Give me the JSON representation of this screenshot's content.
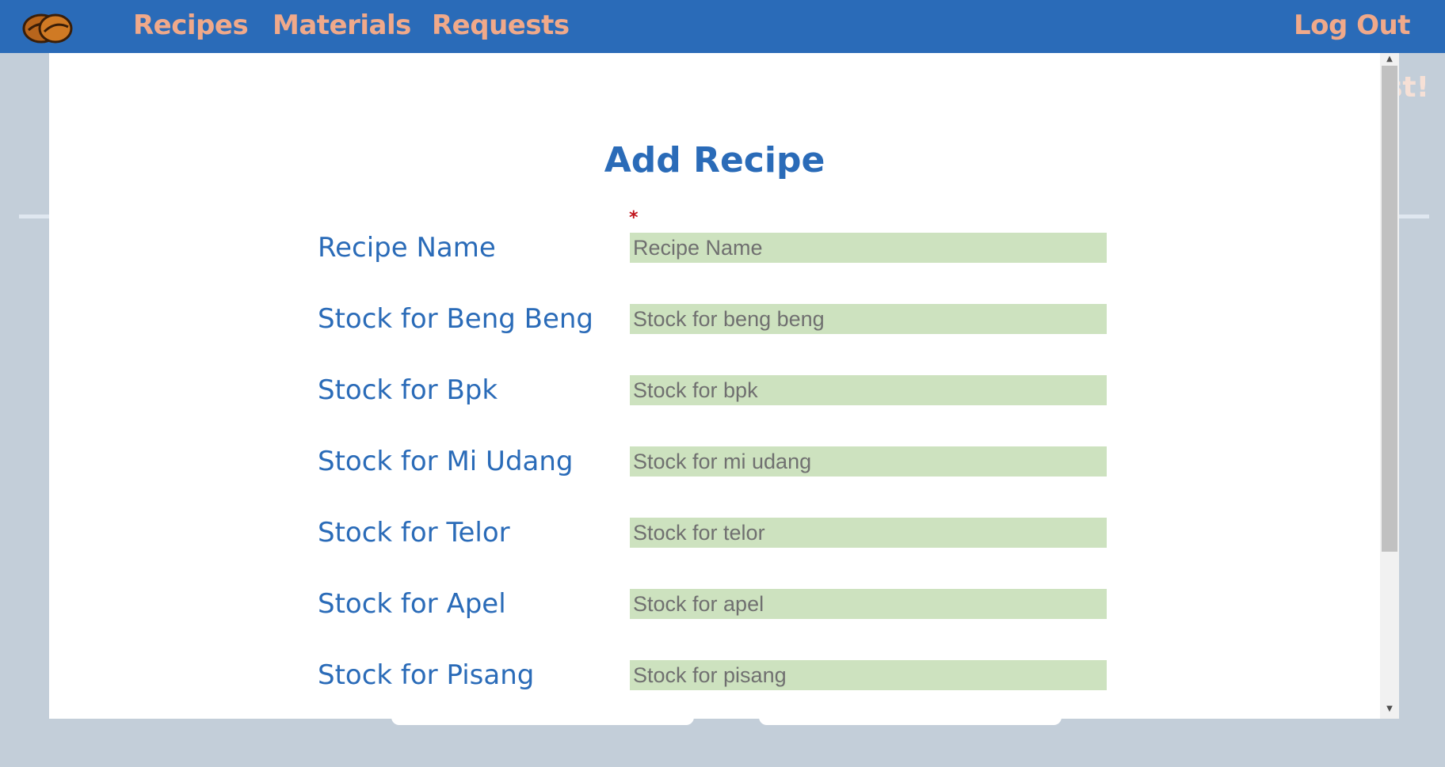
{
  "nav": {
    "logo": "coffee-beans-logo",
    "links": [
      "Recipes",
      "Materials",
      "Requests"
    ],
    "logout": "Log Out"
  },
  "background": {
    "heading_fragment": "st!"
  },
  "modal": {
    "title": "Add Recipe",
    "required_mark": "*",
    "fields": [
      {
        "label": "Recipe Name",
        "placeholder": "Recipe Name",
        "value": ""
      },
      {
        "label": "Stock for Beng Beng",
        "placeholder": "Stock for beng beng",
        "value": ""
      },
      {
        "label": "Stock for Bpk",
        "placeholder": "Stock for bpk",
        "value": ""
      },
      {
        "label": "Stock for Mi Udang",
        "placeholder": "Stock for mi udang",
        "value": ""
      },
      {
        "label": "Stock for Telor",
        "placeholder": "Stock for telor",
        "value": ""
      },
      {
        "label": "Stock for Apel",
        "placeholder": "Stock for apel",
        "value": ""
      },
      {
        "label": "Stock for Pisang",
        "placeholder": "Stock for pisang",
        "value": ""
      }
    ]
  },
  "colors": {
    "navbar": "#2a6bb8",
    "nav_link": "#f0a98a",
    "label": "#2a6bb8",
    "input_bg": "#cde2bf",
    "required": "#c0141c",
    "page_bg": "#c3ced9"
  }
}
